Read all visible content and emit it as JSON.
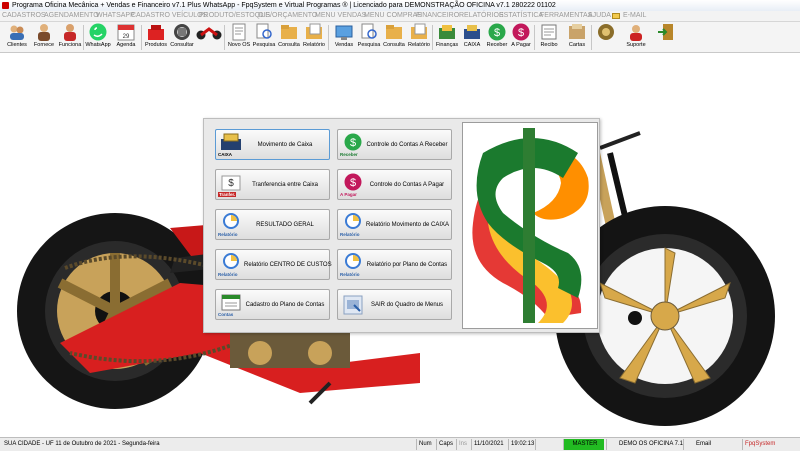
{
  "window": {
    "title": "Programa Oficina Mecânica + Vendas e Financeiro v7.1 Plus WhatsApp - FpqSystem e Virtual Programas ® | Licenciado para  DEMONSTRAÇÃO OFICINA v7.1 280222 01102"
  },
  "menu": [
    "CADASTROS",
    "AGENDAMENTO",
    "WHATSAPP",
    "CADASTRO VEÍCULOS",
    "PRODUTO/ESTOQUE",
    "O.S/ORÇAMENTO",
    "MENU VENDAS",
    "MENU COMPRAS",
    "FINANCEIRO",
    "RELATÓRIOS",
    "ESTATÍSTICA",
    "FERRAMENTAS",
    "AJUDA",
    "E-MAIL"
  ],
  "toolbar": [
    {
      "label": "Clientes",
      "icon": "clients-icon"
    },
    {
      "label": "Fornece",
      "icon": "supplier-icon"
    },
    {
      "label": "Funciona",
      "icon": "employee-icon"
    },
    {
      "label": "WhatsApp",
      "icon": "whatsapp-icon"
    },
    {
      "label": "Agenda",
      "icon": "calendar-icon"
    },
    {
      "label": "Produtos",
      "icon": "products-icon"
    },
    {
      "label": "Consultar",
      "icon": "search-products-icon"
    },
    {
      "label": "",
      "icon": "motorcycle-icon"
    },
    {
      "label": "Novo OS",
      "icon": "new-os-icon"
    },
    {
      "label": "Pesquisa",
      "icon": "os-search-icon"
    },
    {
      "label": "Consulta",
      "icon": "os-query-icon"
    },
    {
      "label": "Relatório",
      "icon": "os-report-icon"
    },
    {
      "label": "Vendas",
      "icon": "sales-icon"
    },
    {
      "label": "Pesquisa",
      "icon": "sales-search-icon"
    },
    {
      "label": "Consulta",
      "icon": "sales-query-icon"
    },
    {
      "label": "Relatório",
      "icon": "sales-report-icon"
    },
    {
      "label": "Finanças",
      "icon": "finance-icon"
    },
    {
      "label": "CAIXA",
      "icon": "cash-icon"
    },
    {
      "label": "Receber",
      "icon": "receivable-icon"
    },
    {
      "label": "A Pagar",
      "icon": "payable-icon"
    },
    {
      "label": "Recibo",
      "icon": "receipt-icon"
    },
    {
      "label": "Cartas",
      "icon": "letters-icon"
    },
    {
      "label": "",
      "icon": "tools-icon"
    },
    {
      "label": "Suporte",
      "icon": "support-icon"
    },
    {
      "label": "",
      "icon": "exit-icon"
    }
  ],
  "panel": {
    "buttons": [
      {
        "label": "Movimento de Caixa",
        "caption": "CAIXA",
        "icon": "cash-register-icon"
      },
      {
        "label": "Controle do Contas A Receber",
        "caption": "Receber",
        "icon": "receivable-icon"
      },
      {
        "label": "Tranferencia entre Caixa",
        "caption": "Tranfer.",
        "icon": "transfer-icon"
      },
      {
        "label": "Controle do Contas A Pagar",
        "caption": "A Pagar",
        "icon": "payable-icon"
      },
      {
        "label": "RESULTADO GERAL",
        "caption": "Relatório",
        "icon": "report-icon"
      },
      {
        "label": "Relatório Movimento de CAIXA",
        "caption": "Relatório",
        "icon": "report-icon"
      },
      {
        "label": "Relatório CENTRO DE CUSTOS",
        "caption": "Relatório",
        "icon": "report-icon"
      },
      {
        "label": "Relatório por Plano de Contas",
        "caption": "Relatório",
        "icon": "report-icon"
      },
      {
        "label": "Cadastro do Plano de Contas",
        "caption": "Contas",
        "icon": "accounts-plan-icon"
      },
      {
        "label": "SAIR do Quadro de Menus",
        "caption": "",
        "icon": "exit-menu-icon"
      }
    ]
  },
  "statusbar": {
    "location": "SUA CIDADE - UF 11 de Outubro de 2021 - Segunda-feira",
    "num": "Num",
    "caps": "Caps",
    "ins": "Ins",
    "date": "11/10/2021",
    "time": "19:02:13",
    "master": "MASTER",
    "demo": "DEMO OS OFICINA 7.1",
    "email": "Email",
    "brand": "FpqSystem"
  },
  "colors": {
    "accent": "#5b9bd5",
    "status_green": "#22bb22",
    "bike_red": "#d81f1f",
    "gold": "#d7a84a"
  }
}
